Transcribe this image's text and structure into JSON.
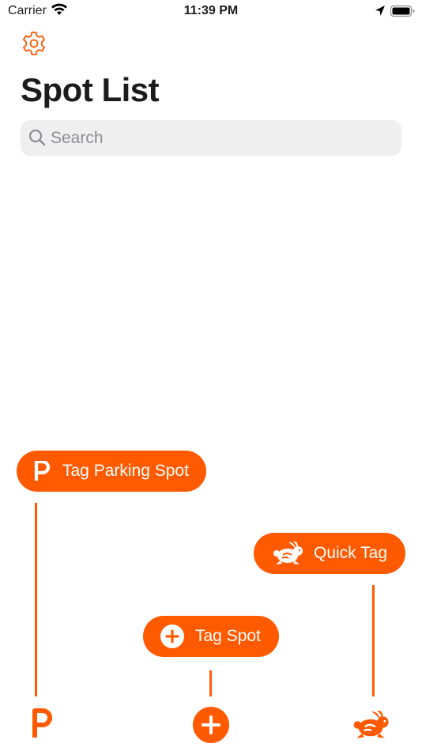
{
  "status_bar": {
    "carrier": "Carrier",
    "time": "11:39 PM"
  },
  "header": {
    "title": "Spot List"
  },
  "search": {
    "placeholder": "Search"
  },
  "actions": {
    "parking_label": "Tag Parking Spot",
    "quick_label": "Quick Tag",
    "tag_spot_label": "Tag Spot"
  },
  "colors": {
    "accent": "#ff5a00",
    "search_bg": "#efeff0"
  },
  "icons": [
    "gear-icon",
    "search-icon",
    "parking-icon",
    "rabbit-icon",
    "plus-circle-icon"
  ]
}
